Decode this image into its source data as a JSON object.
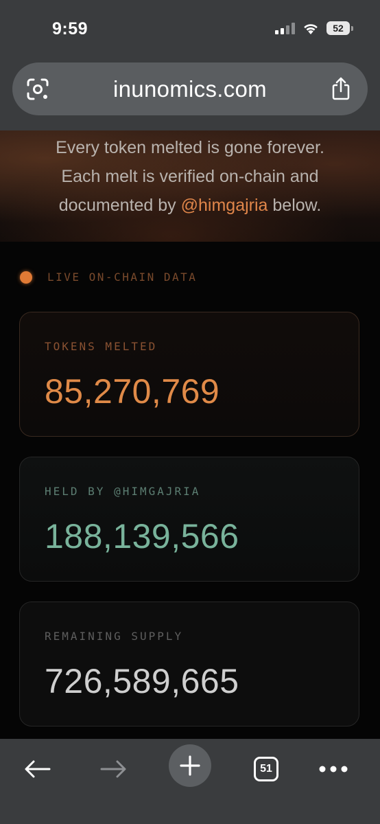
{
  "status_bar": {
    "time": "9:59",
    "battery_level": "52",
    "icons": [
      "cellular-signal-icon",
      "wifi-icon",
      "battery-icon"
    ]
  },
  "browser": {
    "url": "inunomics.com",
    "icons": [
      "visual-search-icon",
      "share-icon"
    ]
  },
  "hero": {
    "line1": "Every token melted is gone forever.",
    "line2": "Each melt is verified on-chain and",
    "line3_prefix": "documented by ",
    "mention": "@himgajria",
    "line3_suffix": " below."
  },
  "live": {
    "label": "LIVE ON-CHAIN DATA"
  },
  "stats": {
    "melted": {
      "label": "TOKENS MELTED",
      "value": "85,270,769"
    },
    "held": {
      "label": "HELD BY @HIMGAJRIA",
      "value": "188,139,566"
    },
    "remaining": {
      "label": "REMAINING SUPPLY",
      "value": "726,589,665"
    }
  },
  "toolbar": {
    "tabs_count": "51",
    "icons": [
      "back-arrow-icon",
      "forward-arrow-icon",
      "plus-icon",
      "tabs-icon",
      "more-icon"
    ]
  },
  "colors": {
    "accent_orange": "#e08a48",
    "accent_green": "#79b39b",
    "browser_chrome": "#3a3c3e",
    "background": "#050505"
  }
}
